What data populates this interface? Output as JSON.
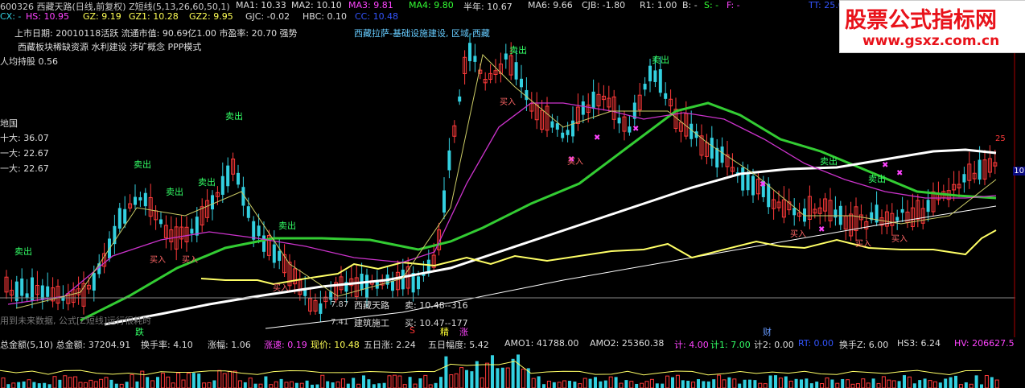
{
  "header": {
    "code_title": "600326 西藏天路(日线,前复权) Z短线(5,13,26,60,50,1)",
    "ma1": "MA1: 10.33",
    "ma2": "MA2: 10.10",
    "ma3": "MA3: 9.81",
    "ma4": "MA4: 9.80",
    "bannian": "半年: 10.67",
    "ma6": "MA6: 9.66",
    "cjb": "CJB: -1.80",
    "r1": "R1: 1.00",
    "b": "B: -",
    "s": "S: -",
    "f": "F: -",
    "tt": "TT: 25.0"
  },
  "row2": {
    "cx": "CX: -",
    "hs": "HS: 10.95",
    "gz": "GZ: 9.19",
    "gz1": "GZ1: 10.28",
    "gz2": "GZ2: 9.95",
    "gjc": "GJC: -0.02",
    "hbc": "HBC: 0.10",
    "cc": "CC: 10.48"
  },
  "info": {
    "listing": "上市日期: 20010118活跃 流通市值: 90.69亿1.00 市盈率: 20.70  强势",
    "concept_right": "西藏拉萨-基础设施建设, 区域-西藏",
    "concepts": "西藏板块稀缺资源 水利建设 涉矿概念 PPP模式",
    "per_capita": "人均持股  0.56",
    "top10_head": "地国",
    "top10": "十大:  36.07",
    "first": "一大:  22.67",
    "first2": "一大:  22.67"
  },
  "price_tags": {
    "low1": "7.87",
    "low2": "7.41",
    "price_25": "25",
    "right_10": "10"
  },
  "trade_box": {
    "name": "西藏天路",
    "industry": "建筑施工",
    "sell": "卖:  10.48--316",
    "buy": "买:  10.47--177"
  },
  "signals": {
    "sell": "卖出",
    "buy": "买入"
  },
  "warning": "用到未来数据, 公式[Z短线]运行很耗时",
  "markers": {
    "die": "跌",
    "jing": "精",
    "zhang": "涨",
    "cai": "财",
    "s": "S"
  },
  "bottom": {
    "zje": "总金额(5,10) 总金额: 37204.91",
    "hsl": "换手率: 4.10",
    "zf": "涨幅: 1.06",
    "zs": "涨速: 0.19",
    "xj": "现价: 10.48",
    "wrz": "五日涨: 2.24",
    "wrfd": "五日幅度: 5.42",
    "amo1": "AMO1: 41788.00",
    "amo2": "AMO2: 25360.38",
    "ji": "计: 4.00",
    "ji1": "计1: 7.00",
    "ji2": "计2: 0.00",
    "rt": "RT: 0.00",
    "hsz": "换手Z: 6.00",
    "hs3": "HS3: 6.24",
    "hv": "HV: 206627.5"
  },
  "watermark": {
    "title": "股票公式指标网",
    "url": "www.gsxz.com.cn"
  },
  "colors": {
    "up": "#ff3a3a",
    "down": "#33d0e0",
    "ma_green": "#33cc33",
    "ma_white": "#ffffff",
    "ma_yellow": "#ffff66",
    "ma_magenta": "#cc33cc"
  }
}
